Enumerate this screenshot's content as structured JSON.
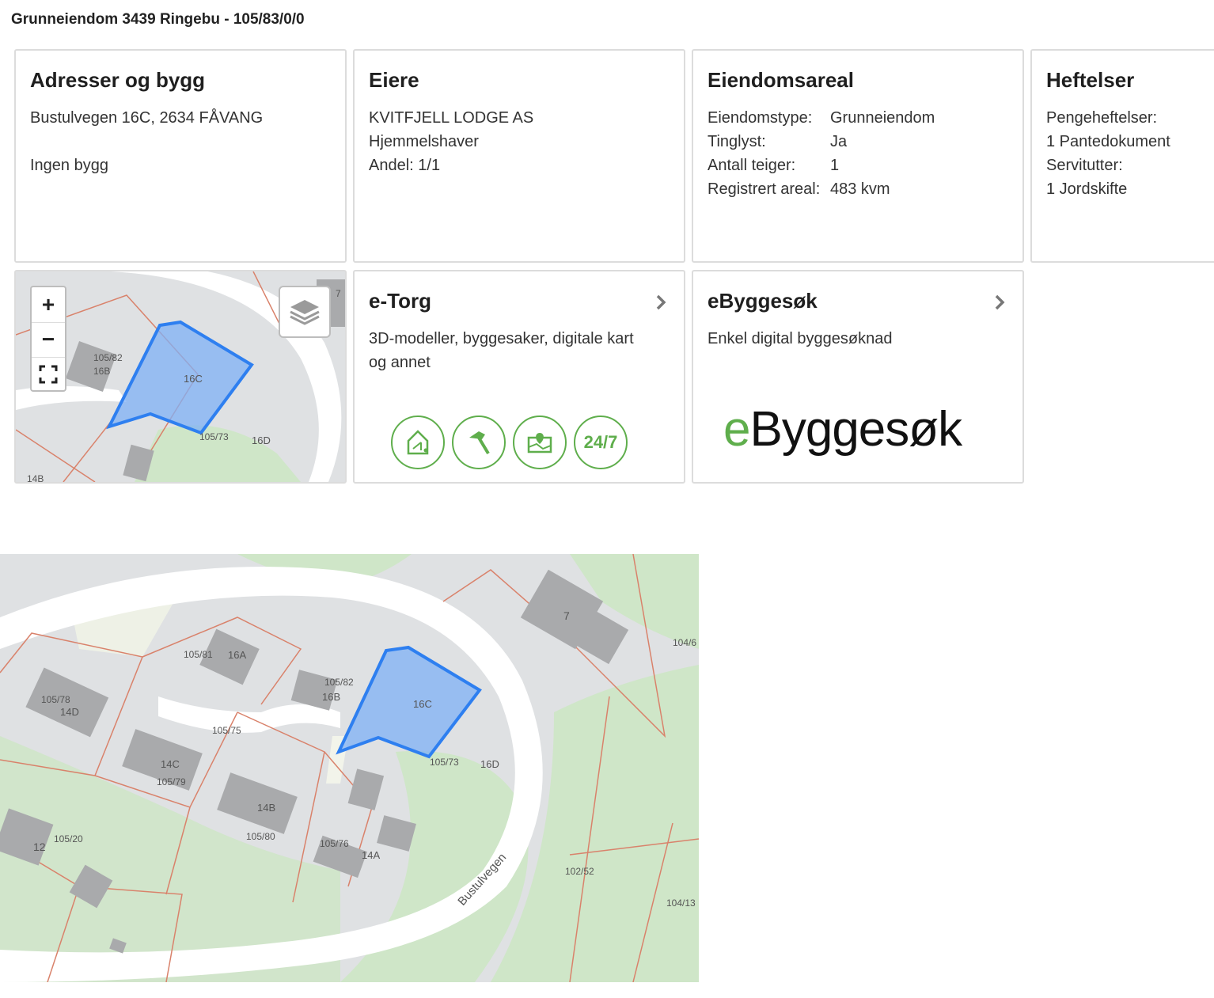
{
  "page": {
    "title": "Grunneiendom 3439 Ringebu - 105/83/0/0"
  },
  "addresses": {
    "title": "Adresser og bygg",
    "address": "Bustulvegen 16C, 2634 FÅVANG",
    "buildings": "Ingen bygg"
  },
  "owners": {
    "title": "Eiere",
    "name": "KVITFJELL LODGE AS",
    "role": "Hjemmelshaver",
    "share": "Andel: 1/1"
  },
  "area": {
    "title": "Eiendomsareal",
    "rows": [
      {
        "key": "Eiendomstype:",
        "value": "Grunneiendom"
      },
      {
        "key": "Tinglyst:",
        "value": "Ja"
      },
      {
        "key": "Antall teiger:",
        "value": "1"
      },
      {
        "key": "Registrert areal:",
        "value": "483 kvm"
      }
    ]
  },
  "encumbrances": {
    "title": "Heftelser",
    "lines": [
      "Pengeheftelser:",
      "1 Pantedokument",
      "Servitutter:",
      "1 Jordskifte"
    ]
  },
  "etorg": {
    "title": "e-Torg",
    "desc1": "3D-modeller, byggesaker, digitale kart",
    "desc2": "og annet",
    "badge_247": "24/7"
  },
  "ebyggesok": {
    "title": "eByggesøk",
    "desc": "Enkel digital byggesøknad",
    "logo_e": "e",
    "logo_rest": "Byggesøk"
  },
  "map_controls": {
    "zoom_in": "+",
    "zoom_out": "−"
  },
  "small_map_labels": {
    "l1": "105/82",
    "l2": "16B",
    "l3": "16C",
    "l4": "105/73",
    "l5": "16D",
    "l6": "7",
    "l7": "14B"
  },
  "large_map_labels": {
    "a": "105/81",
    "b": "16A",
    "c": "105/82",
    "d": "16B",
    "e": "105/78",
    "f": "14D",
    "g": "105/75",
    "h": "16C",
    "i": "105/73",
    "j": "16D",
    "k": "14C",
    "l": "105/79",
    "m": "14B",
    "n": "105/80",
    "o": "105/76",
    "p": "14A",
    "q": "12",
    "r": "105/20",
    "s": "7",
    "t": "104/6",
    "u": "104/13",
    "v": "102/52",
    "w": "Bustulvegen"
  },
  "colors": {
    "map_bg": "#dfe1e3",
    "green": "#cfe6c8",
    "road": "#ffffff",
    "parcel_line": "#d9826b",
    "building": "#a9aaac",
    "highlight_fill": "#7fb0f5",
    "highlight_stroke": "#2e7ff0",
    "brand_green": "#5fae4c"
  }
}
